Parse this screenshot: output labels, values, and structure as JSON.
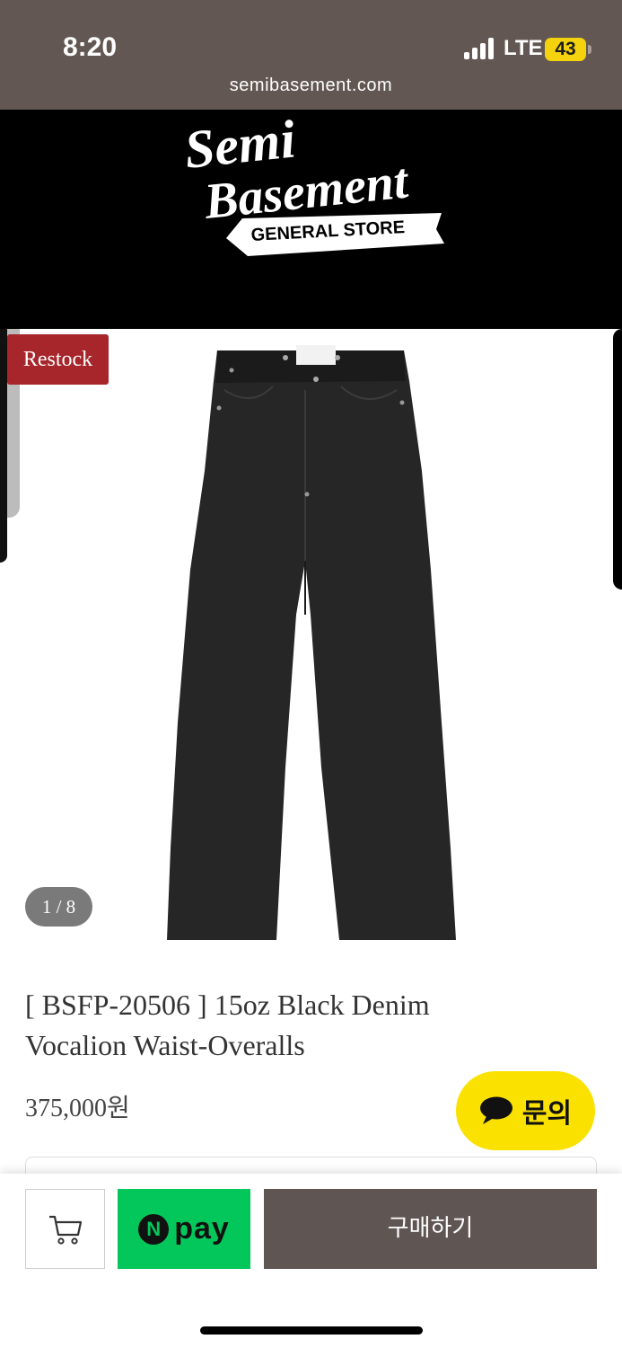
{
  "status_bar": {
    "time": "8:20",
    "network": "LTE",
    "battery": "43",
    "battery_color": "#f5d20e"
  },
  "browser": {
    "url": "semibasement.com",
    "bar_color": "#625752"
  },
  "header": {
    "logo_line1": "Semi",
    "logo_line2": "Basement",
    "logo_banner": "GENERAL STORE"
  },
  "gallery": {
    "badge": "Restock",
    "badge_color": "#a6262b",
    "counter": "1 / 8",
    "image_icon": "black-denim-jeans"
  },
  "product": {
    "title_line1": "[ BSFP-20506 ] 15oz Black Denim",
    "title_line2": "Vocalion Waist-Overalls",
    "price": "375,000원"
  },
  "inquiry": {
    "label": "문의",
    "icon": "chat-bubble-icon",
    "color": "#fae100"
  },
  "actions": {
    "cart_icon": "cart-icon",
    "npay_n": "N",
    "npay_label": "pay",
    "npay_color": "#03c75a",
    "buy_label": "구매하기",
    "buy_color": "#5f5553"
  }
}
